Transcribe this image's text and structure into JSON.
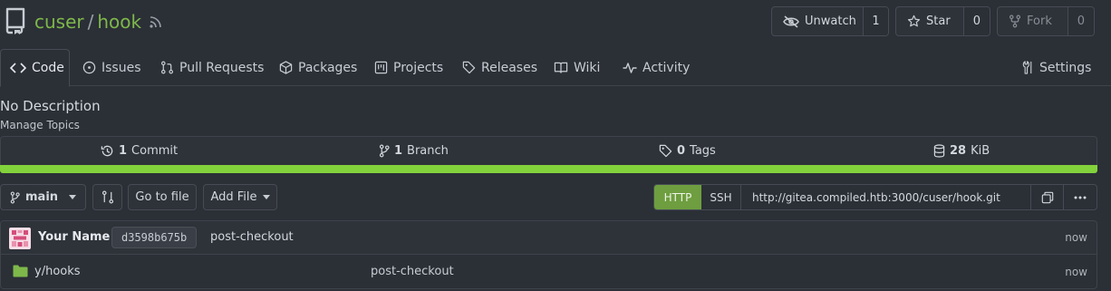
{
  "repo": {
    "owner": "cuser",
    "separator": "/",
    "name": "hook"
  },
  "header_buttons": {
    "watch": {
      "label": "Unwatch",
      "count": "1"
    },
    "star": {
      "label": "Star",
      "count": "0"
    },
    "fork": {
      "label": "Fork",
      "count": "0"
    }
  },
  "tabs": [
    {
      "label": "Code",
      "icon": "code-icon",
      "active": true
    },
    {
      "label": "Issues",
      "icon": "issue-icon"
    },
    {
      "label": "Pull Requests",
      "icon": "pull-request-icon"
    },
    {
      "label": "Packages",
      "icon": "package-icon"
    },
    {
      "label": "Projects",
      "icon": "project-icon"
    },
    {
      "label": "Releases",
      "icon": "tag-icon"
    },
    {
      "label": "Wiki",
      "icon": "book-icon"
    },
    {
      "label": "Activity",
      "icon": "pulse-icon"
    },
    {
      "label": "Settings",
      "icon": "tools-icon"
    }
  ],
  "description": "No Description",
  "manage_topics": "Manage Topics",
  "stats": {
    "commits": {
      "num": "1",
      "label": "Commit"
    },
    "branches": {
      "num": "1",
      "label": "Branch"
    },
    "tags": {
      "num": "0",
      "label": "Tags"
    },
    "size": {
      "num": "28",
      "label": "KiB"
    }
  },
  "language_bar_color": "#82d23c",
  "toolbar": {
    "branch": "main",
    "goto_file": "Go to file",
    "add_file": "Add File",
    "clone": {
      "http": "HTTP",
      "ssh": "SSH",
      "url": "http://gitea.compiled.htb:3000/cuser/hook.git"
    }
  },
  "latest_commit": {
    "author": "Your Name",
    "sha": "d3598b675b",
    "message": "post-checkout",
    "time": "now"
  },
  "files": [
    {
      "name": "y/hooks",
      "type": "folder",
      "message": "post-checkout",
      "time": "now"
    }
  ],
  "colors": {
    "accent": "#7eb84a",
    "background": "#2b2f36",
    "http_active": "#6e9e3f",
    "folder": "#7eb84a"
  }
}
